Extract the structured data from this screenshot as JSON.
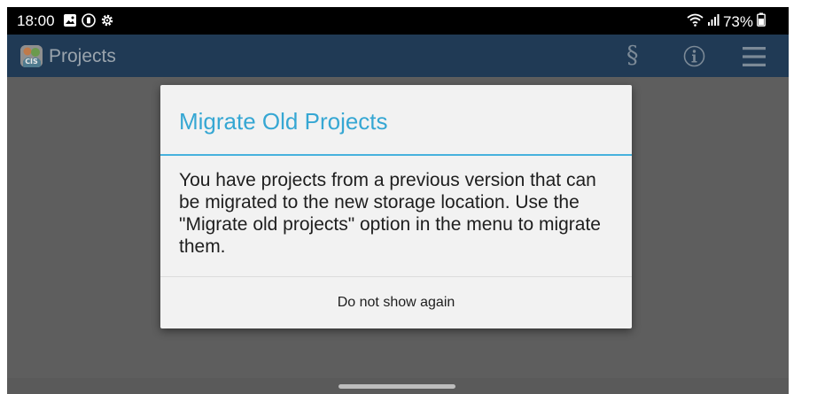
{
  "status_bar": {
    "time": "18:00",
    "left_icons": [
      "gallery-icon",
      "record-icon",
      "settings-icon"
    ],
    "right_icons": [
      "wifi-icon",
      "signal-icon",
      "battery-icon"
    ],
    "battery": "73%"
  },
  "app_bar": {
    "title": "Projects",
    "actions": [
      "section-icon",
      "info-icon",
      "menu-icon"
    ],
    "color": "#203a55",
    "section_symbol": "§"
  },
  "dialog": {
    "title": "Migrate Old Projects",
    "message": "You have projects from a previous version that can be migrated to the new storage location. Use the \"Migrate old projects\" option in the menu to migrate them.",
    "button_label": "Do not show again",
    "title_color": "#36a7d3"
  }
}
